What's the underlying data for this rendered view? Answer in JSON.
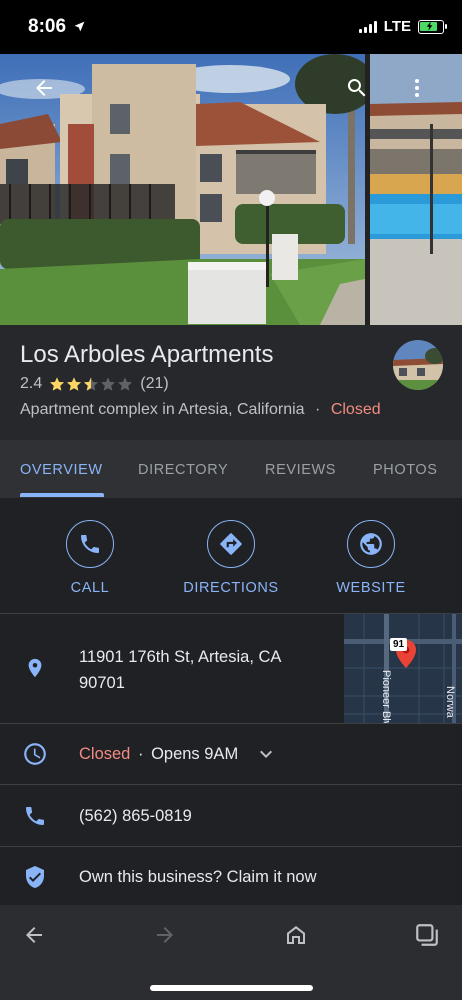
{
  "status_bar": {
    "time": "8:06",
    "network": "LTE",
    "battery_level": 0.85
  },
  "hero": {
    "back_icon": "arrow-back-icon",
    "search_icon": "search-icon",
    "more_icon": "more-vert-icon"
  },
  "place": {
    "name": "Los Arboles Apartments",
    "rating": "2.4",
    "rating_value": 2.4,
    "review_count": "(21)",
    "type": "Apartment complex in Artesia, California",
    "separator": "·",
    "status": "Closed"
  },
  "tabs": [
    {
      "label": "OVERVIEW",
      "active": true
    },
    {
      "label": "DIRECTORY",
      "active": false
    },
    {
      "label": "REVIEWS",
      "active": false
    },
    {
      "label": "PHOTOS",
      "active": false
    }
  ],
  "actions": [
    {
      "label": "CALL",
      "icon": "phone-icon"
    },
    {
      "label": "DIRECTIONS",
      "icon": "directions-icon"
    },
    {
      "label": "WEBSITE",
      "icon": "globe-icon"
    }
  ],
  "info": {
    "address_line1": "11901 176th St, Artesia, CA",
    "address_line2": "90701",
    "hours_status": "Closed",
    "hours_sep": "·",
    "hours_opens": "Opens 9AM",
    "phone": "(562) 865-0819",
    "claim": "Own this business? Claim it now"
  },
  "map": {
    "route_badge": "91",
    "street_1": "Pioneer Blvd",
    "street_2": "Norwa"
  },
  "colors": {
    "accent": "#8ab4f8",
    "closed": "#f28b82",
    "star": "#fdd663",
    "background": "#202124"
  },
  "bottom_nav": [
    "back-arrow-icon",
    "forward-arrow-icon",
    "home-icon",
    "tabs-icon"
  ]
}
